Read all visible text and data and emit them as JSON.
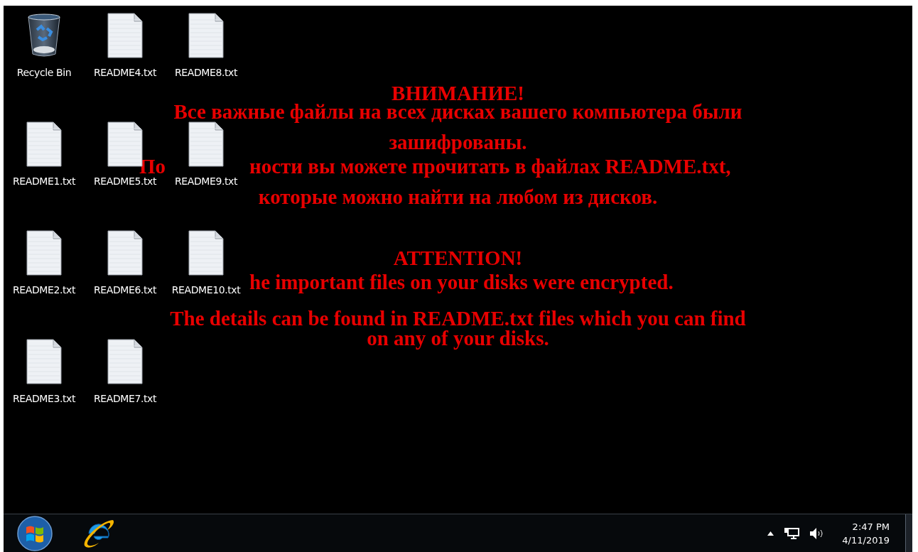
{
  "desktop": {
    "icon_columns": [
      [
        {
          "kind": "recycle-bin",
          "label": "Recycle Bin"
        },
        {
          "kind": "text-file",
          "label": "README1.txt"
        },
        {
          "kind": "text-file",
          "label": "README2.txt"
        },
        {
          "kind": "text-file",
          "label": "README3.txt"
        }
      ],
      [
        {
          "kind": "text-file",
          "label": "README4.txt"
        },
        {
          "kind": "text-file",
          "label": "README5.txt"
        },
        {
          "kind": "text-file",
          "label": "README6.txt"
        },
        {
          "kind": "text-file",
          "label": "README7.txt"
        }
      ],
      [
        {
          "kind": "text-file",
          "label": "README8.txt"
        },
        {
          "kind": "text-file",
          "label": "README9.txt"
        },
        {
          "kind": "text-file",
          "label": "README10.txt"
        }
      ]
    ]
  },
  "wallpaper": {
    "messages": [
      {
        "heading": "ВНИМАНИЕ!",
        "lines": [
          {
            "text": "Все важные файлы на всех дисках вашего компьютера были"
          },
          {
            "text": "зашифрованы."
          },
          {
            "left": "По",
            "right": "ности вы можете прочитать в файлах README.txt,"
          },
          {
            "text": "которые можно найти на любом из дисков."
          }
        ]
      },
      {
        "heading": "ATTENTION!",
        "lines": [
          {
            "right": "he important files on your disks were encrypted."
          },
          {
            "text": "The details can be found in README.txt files which you can find"
          },
          {
            "text": "on any of your disks."
          }
        ]
      }
    ]
  },
  "taskbar": {
    "pinned": [
      {
        "kind": "start"
      },
      {
        "kind": "browser"
      }
    ],
    "clock": {
      "time": "2:47 PM",
      "date": "4/11/2019"
    }
  }
}
